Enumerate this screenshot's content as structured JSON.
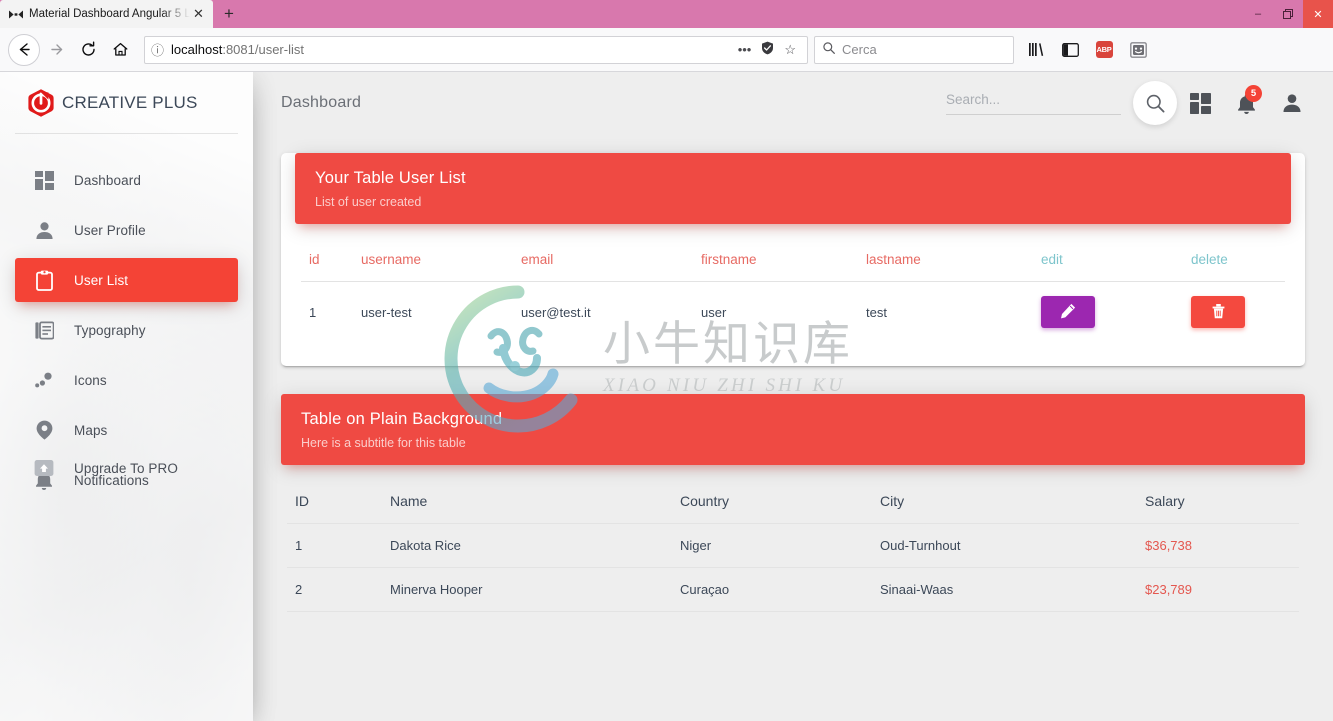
{
  "browser": {
    "tab": {
      "title": "Material Dashboard Angular 5 L",
      "favicon": "bowtie-icon",
      "close": "✕"
    },
    "newtab_label": "+",
    "window_controls": {
      "minimize": "‒",
      "maximize": "❐",
      "close": "✕"
    },
    "nav": {
      "back": "←",
      "forward": "→",
      "reload": "⟳",
      "home": "⌂"
    },
    "url": {
      "info_icon": "ⓘ",
      "host": "localhost",
      "path": ":8081/user-list",
      "menu_icon": "•••",
      "shield_icon": "shield",
      "bookmark_icon": "☆"
    },
    "search": {
      "placeholder": "Cerca",
      "icon": "search-icon"
    },
    "toolbar_icons": [
      "library-icon",
      "sidebar-icon",
      "ABP",
      "screenshot-icon"
    ]
  },
  "sidebar": {
    "brand": "CREATIVE PLUS",
    "logo": "power-hexagon-icon",
    "items": [
      {
        "label": "Dashboard",
        "icon": "dashboard-icon",
        "active": false
      },
      {
        "label": "User Profile",
        "icon": "person-icon",
        "active": false
      },
      {
        "label": "User List",
        "icon": "clipboard-icon",
        "active": true
      },
      {
        "label": "Typography",
        "icon": "typography-icon",
        "active": false
      },
      {
        "label": "Icons",
        "icon": "bubble-chart-icon",
        "active": false
      },
      {
        "label": "Maps",
        "icon": "map-pin-icon",
        "active": false
      },
      {
        "label": "Notifications",
        "icon": "bell-icon",
        "active": false
      }
    ],
    "bottom_item": {
      "label": "Upgrade To PRO",
      "icon": "upgrade-icon"
    }
  },
  "topnav": {
    "title": "Dashboard",
    "search": {
      "value": "",
      "placeholder": "Search..."
    },
    "search_button_icon": "search-icon",
    "dashboard_icon": "grid-icon",
    "notifications": {
      "icon": "bell-icon",
      "badge": "5"
    },
    "profile_icon": "person-icon"
  },
  "cards": [
    {
      "title": "Your Table User List",
      "subtitle": "List of user created",
      "plain": false,
      "columns": [
        {
          "label": "id",
          "style": "red"
        },
        {
          "label": "username",
          "style": "red"
        },
        {
          "label": "email",
          "style": "red"
        },
        {
          "label": "firstname",
          "style": "red"
        },
        {
          "label": "lastname",
          "style": "red"
        },
        {
          "label": "edit",
          "style": "teal"
        },
        {
          "label": "delete",
          "style": "teal"
        }
      ],
      "rows": [
        {
          "id": "1",
          "username": "user-test",
          "email": "user@test.it",
          "firstname": "user",
          "lastname": "test",
          "edit_icon": "pencil-icon",
          "delete_icon": "trash-icon"
        }
      ]
    },
    {
      "title": "Table on Plain Background",
      "subtitle": "Here is a subtitle for this table",
      "plain": true,
      "columns": [
        {
          "label": "ID",
          "style": "dark"
        },
        {
          "label": "Name",
          "style": "dark"
        },
        {
          "label": "Country",
          "style": "dark"
        },
        {
          "label": "City",
          "style": "dark"
        },
        {
          "label": "Salary",
          "style": "dark"
        }
      ],
      "rows": [
        {
          "id": "1",
          "name": "Dakota Rice",
          "country": "Niger",
          "city": "Oud-Turnhout",
          "salary": "$36,738"
        },
        {
          "id": "2",
          "name": "Minerva Hooper",
          "country": "Curaçao",
          "city": "Sinaai-Waas",
          "salary": "$23,789"
        }
      ]
    }
  ],
  "watermark": {
    "chinese": "小牛知识库",
    "pinyin": "XIAO NIU ZHI SHI KU",
    "logo": "ox-circle-icon"
  },
  "colors": {
    "brand_red": "#f44336",
    "card_header_red": "#ef4a43",
    "edit_purple": "#9c27b0",
    "header_teal": "#7ec5cc",
    "header_salmon": "#e76a63",
    "salary_red": "#e4574f",
    "titlebar_pink": "#d878ad"
  }
}
